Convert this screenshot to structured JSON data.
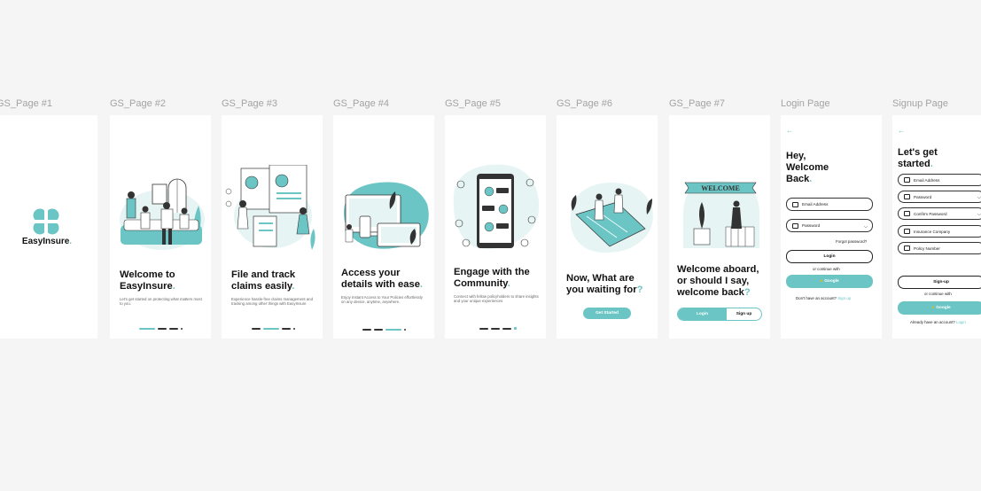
{
  "labels": [
    "GS_Page #1",
    "GS_Page #2",
    "GS_Page #3",
    "GS_Page #4",
    "GS_Page #5",
    "GS_Page #6",
    "GS_Page #7",
    "Login Page",
    "Signup Page"
  ],
  "colors": {
    "accent": "#6cc5c5",
    "canvas": "#f5f5f5",
    "frame": "#ffffff",
    "text": "#111111"
  },
  "splash": {
    "brand": "EasyInsure",
    "brand_dot": "."
  },
  "p2": {
    "title_1": "Welcome to",
    "title_2": "EasyInsure",
    "title_dot": ".",
    "subtitle": "Let's get started on protecting what matters most to you."
  },
  "p3": {
    "title_1": "File and track",
    "title_2": "claims easily",
    "title_dot": ".",
    "subtitle": "Experience hassle-free claims management and tracking among other things with EasyInsure"
  },
  "p4": {
    "title_1": "Access your",
    "title_2": "details with ease",
    "title_dot": ".",
    "subtitle": "Enjoy Instant Access to Your Policies effortlessly on any device, anytime, anywhere."
  },
  "p5": {
    "title_1": "Engage with the",
    "title_2": "Community",
    "title_dot": ".",
    "subtitle": "Connect with fellow policyholders to share insights and your unique experiences"
  },
  "p6": {
    "title_1": "Now, What are",
    "title_2": "you waiting for",
    "title_q": "?",
    "button": "Get Started"
  },
  "p7": {
    "title_1": "Welcome aboard,",
    "title_2": "or should I say,",
    "title_3": "welcome back",
    "title_q": "?",
    "login": "Login",
    "signup": "Sign up",
    "banner": "WELCOME"
  },
  "login": {
    "back": "←",
    "title_1": "Hey,",
    "title_2": "Welcome",
    "title_3": "Back",
    "title_dot": ".",
    "email_placeholder": "Email Address",
    "password_placeholder": "Password",
    "forgot": "Forgot password?",
    "login_button": "Login",
    "or_continue": "or continue with",
    "google_button": "Google",
    "no_account": "Don't have an account?",
    "signup_link": "Sign up"
  },
  "signup": {
    "back": "←",
    "title_1": "Let's get",
    "title_2": "started",
    "title_dot": ".",
    "email_placeholder": "Email Address",
    "password_placeholder": "Password",
    "confirm_placeholder": "Confirm Password",
    "company_placeholder": "Insurance Company",
    "policy_placeholder": "Policy Number",
    "signup_button": "Sign-up",
    "or_continue": "or continue with",
    "google_button": "Google",
    "have_account": "Already have an account?",
    "login_link": "Login"
  }
}
